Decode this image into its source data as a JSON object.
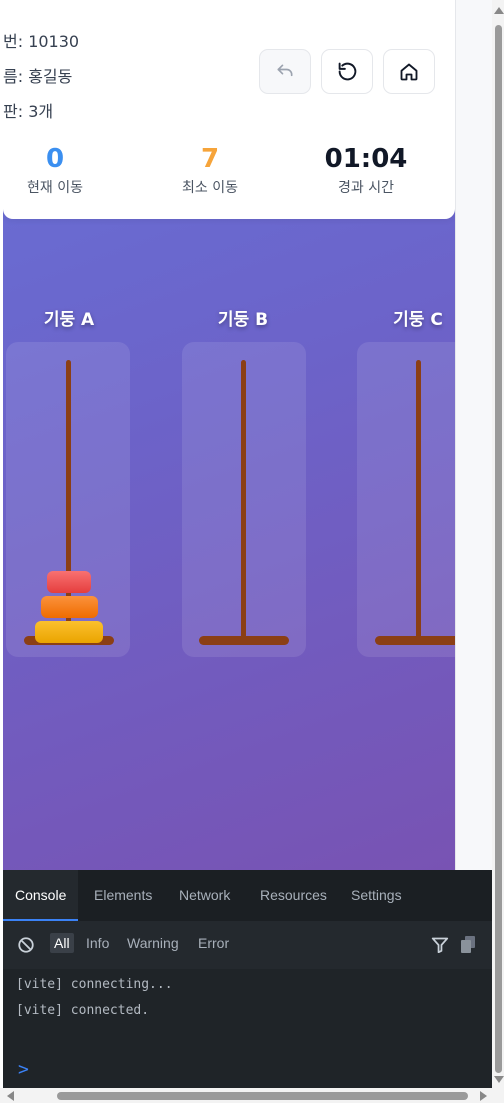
{
  "header": {
    "info": [
      {
        "label": "번: 10130"
      },
      {
        "label": "름: 홍길동"
      },
      {
        "label": "판: 3개"
      }
    ],
    "buttons": [
      "undo-icon",
      "restart-icon",
      "home-icon"
    ],
    "stats": [
      {
        "value": "0",
        "label": "현재 이동",
        "color": "#3b8ff0"
      },
      {
        "value": "7",
        "label": "최소 이동",
        "color": "#f6a43a"
      },
      {
        "value": "01:04",
        "label": "경과 시간",
        "color": "#111827"
      }
    ]
  },
  "pegs": [
    {
      "title": "기둥 A",
      "disks": [
        "small",
        "medium",
        "large"
      ]
    },
    {
      "title": "기둥 B",
      "disks": []
    },
    {
      "title": "기둥 C",
      "disks": []
    }
  ],
  "colors": {
    "bg_gradient_start": "#6772d8",
    "bg_gradient_end": "#7853b3",
    "rod": "#8b3f15",
    "disk_small": "#ef4444",
    "disk_medium": "#f97316",
    "disk_large": "#f5b700"
  },
  "devtools": {
    "tabs": [
      "Console",
      "Elements",
      "Network",
      "Resources",
      "Settings"
    ],
    "active_tab": "Console",
    "filters": [
      "All",
      "Info",
      "Warning",
      "Error"
    ],
    "active_filter": "All",
    "logs": [
      "[vite] connecting...",
      "[vite] connected."
    ],
    "prompt": ">"
  }
}
